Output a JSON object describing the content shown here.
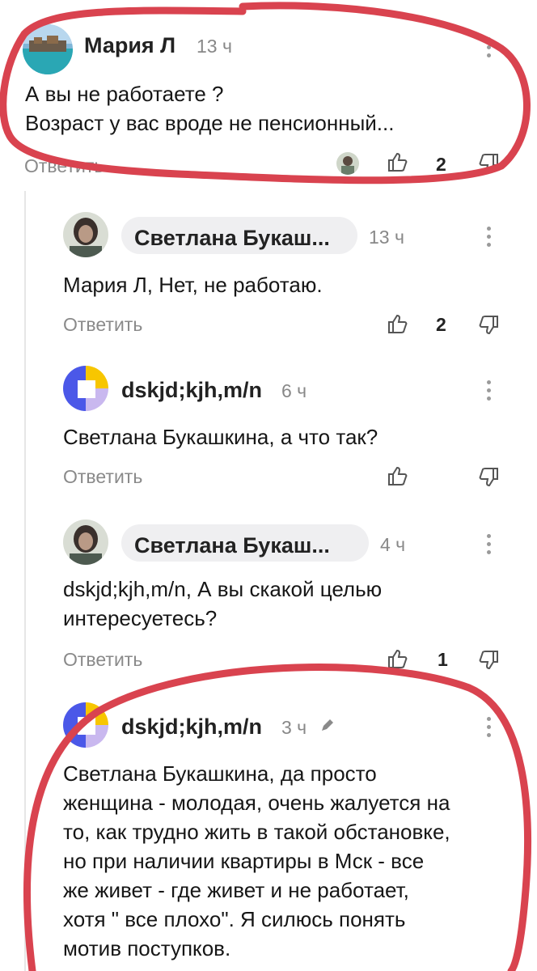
{
  "comments": [
    {
      "author": "Мария Л",
      "time": "13 ч",
      "text_lines": [
        "А вы не работаете ?",
        "Возраст у вас вроде не пенсионный..."
      ],
      "reply_label": "Ответить",
      "likes": "2"
    },
    {
      "author": "Светлана Букаш...",
      "time": "13 ч",
      "text_lines": [
        "Мария Л, Нет, не работаю."
      ],
      "reply_label": "Ответить",
      "likes": "2"
    },
    {
      "author": "dskjd;kjh,m/n",
      "time": "6 ч",
      "text_lines": [
        "Светлана Букашкина, а что так?"
      ],
      "reply_label": "Ответить",
      "likes": ""
    },
    {
      "author": "Светлана Букаш...",
      "time": "4 ч",
      "text_lines": [
        "dskjd;kjh,m/n, А вы скакой целью",
        "интересуетесь?"
      ],
      "reply_label": "Ответить",
      "likes": "1"
    },
    {
      "author": "dskjd;kjh,m/n",
      "time": "3 ч",
      "text_lines": [
        "Светлана Букашкина, да просто",
        "женщина - молодая, очень жалуется на",
        "то, как трудно жить в такой обстановке,",
        "но при наличии квартиры в Мск - все",
        "же живет - где живет и не работает,",
        "хотя \" все плохо\". Я силюсь понять",
        "мотив поступков."
      ]
    }
  ],
  "colors": {
    "annotation_red": "#d9434f",
    "avatar_blue": "#4b58e8",
    "avatar_yellow": "#f7c600",
    "avatar_lavender": "#c9b8ef"
  }
}
